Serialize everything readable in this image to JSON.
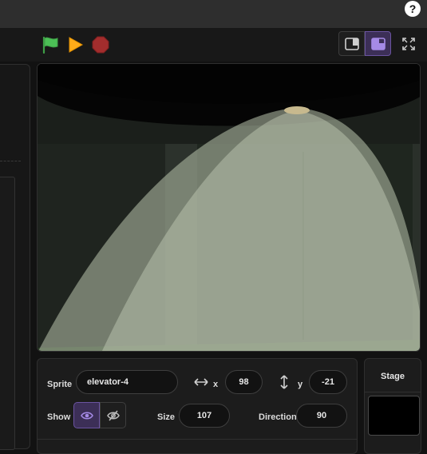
{
  "header": {
    "help_label": "?"
  },
  "controls": {
    "green_flag_icon": "green-flag-icon",
    "play_icon": "play-icon",
    "stop_icon": "stop-icon"
  },
  "view_modes": {
    "small_stage_icon": "small-stage-icon",
    "large_stage_icon": "large-stage-icon",
    "fullscreen_icon": "fullscreen-icon"
  },
  "sprite_info": {
    "sprite_label": "Sprite",
    "sprite_name": "elevator-4",
    "x_label": "x",
    "x_value": "98",
    "y_label": "y",
    "y_value": "-21",
    "show_label": "Show",
    "size_label": "Size",
    "size_value": "107",
    "direction_label": "Direction",
    "direction_value": "90"
  },
  "stage_panel": {
    "title": "Stage"
  },
  "colors": {
    "accent_purple": "#855cd6",
    "flag_green": "#4cbf56",
    "play_orange": "#ffab19",
    "stop_red": "#a32d2d"
  }
}
